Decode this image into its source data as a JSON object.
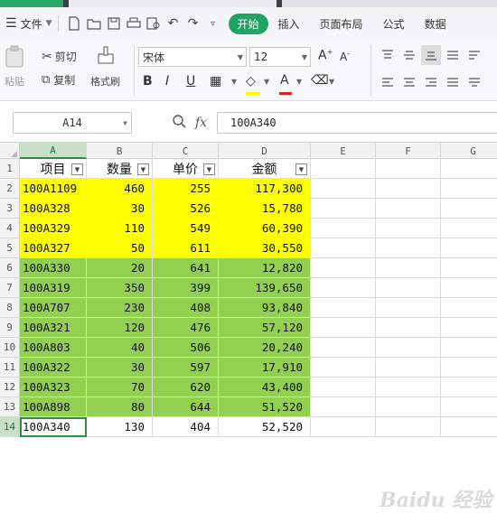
{
  "menubar": {
    "file_label": "文件",
    "tabs": [
      "开始",
      "插入",
      "页面布局",
      "公式",
      "数据"
    ]
  },
  "ribbon": {
    "paste_label": "粘贴",
    "cut_label": "剪切",
    "copy_label": "复制",
    "format_painter_label": "格式刷",
    "font_name": "宋体",
    "font_size": "12",
    "bold": "B",
    "italic": "I",
    "underline": "U"
  },
  "formula_bar": {
    "name_box": "A14",
    "fx_label": "fx",
    "formula": "100A340"
  },
  "grid": {
    "columns": [
      "A",
      "B",
      "C",
      "D",
      "E",
      "F",
      "G"
    ],
    "header_row": [
      "项目",
      "数量",
      "单价",
      "金额"
    ],
    "rows": [
      {
        "num": "2",
        "a": "100A1109",
        "b": "460",
        "c": "255",
        "d": "117,300",
        "fill": "#ffff00"
      },
      {
        "num": "3",
        "a": "100A328",
        "b": "30",
        "c": "526",
        "d": "15,780",
        "fill": "#ffff00"
      },
      {
        "num": "4",
        "a": "100A329",
        "b": "110",
        "c": "549",
        "d": "60,390",
        "fill": "#ffff00"
      },
      {
        "num": "5",
        "a": "100A327",
        "b": "50",
        "c": "611",
        "d": "30,550",
        "fill": "#ffff00"
      },
      {
        "num": "6",
        "a": "100A330",
        "b": "20",
        "c": "641",
        "d": "12,820",
        "fill": "#92d050"
      },
      {
        "num": "7",
        "a": "100A319",
        "b": "350",
        "c": "399",
        "d": "139,650",
        "fill": "#92d050"
      },
      {
        "num": "8",
        "a": "100A707",
        "b": "230",
        "c": "408",
        "d": "93,840",
        "fill": "#92d050"
      },
      {
        "num": "9",
        "a": "100A321",
        "b": "120",
        "c": "476",
        "d": "57,120",
        "fill": "#92d050"
      },
      {
        "num": "10",
        "a": "100A803",
        "b": "40",
        "c": "506",
        "d": "20,240",
        "fill": "#92d050"
      },
      {
        "num": "11",
        "a": "100A322",
        "b": "30",
        "c": "597",
        "d": "17,910",
        "fill": "#92d050"
      },
      {
        "num": "12",
        "a": "100A323",
        "b": "70",
        "c": "620",
        "d": "43,400",
        "fill": "#92d050"
      },
      {
        "num": "13",
        "a": "100A898",
        "b": "80",
        "c": "644",
        "d": "51,520",
        "fill": "#92d050"
      },
      {
        "num": "14",
        "a": "100A340",
        "b": "130",
        "c": "404",
        "d": "52,520",
        "fill": "#ffffff"
      }
    ]
  },
  "watermark": "Baidu 经验"
}
